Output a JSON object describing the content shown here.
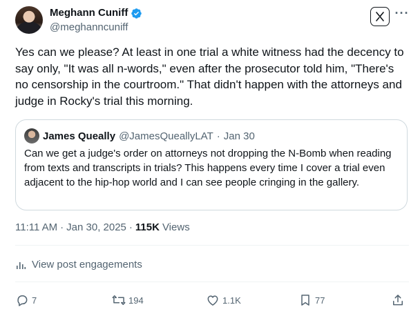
{
  "author": {
    "display_name": "Meghann Cuniff",
    "handle": "@meghanncuniff",
    "verified_icon": "verified-badge-icon"
  },
  "header": {
    "grok_icon": "grok-icon",
    "more_label": "···"
  },
  "tweet": {
    "text": "Yes can we please? At least in one trial a white witness had the decency to say only, \"It was all n-words,\" even after the prosecutor told him, \"There's no censorship in the courtroom.\" That didn't happen with the attorneys and judge in Rocky's trial this morning."
  },
  "quote": {
    "name": "James Queally",
    "handle": "@JamesQueallyLAT",
    "separator": "·",
    "date": "Jan 30",
    "text": "Can we get a judge's order on attorneys not dropping the N-Bomb when reading from texts and transcripts in trials? This happens every time I cover a trial even adjacent to the hip-hop world and I can see people cringing in the gallery."
  },
  "meta": {
    "time": "11:11 AM",
    "separator": "·",
    "date": "Jan 30, 2025",
    "views_count": "115K",
    "views_label": "Views"
  },
  "engagements": {
    "label": "View post engagements",
    "icon": "analytics-icon"
  },
  "actions": {
    "replies": "7",
    "reposts": "194",
    "likes": "1.1K",
    "bookmarks": "77"
  },
  "colors": {
    "text": "#0f1419",
    "secondary": "#536471",
    "accent": "#1d9bf0",
    "border": "#cfd9de"
  }
}
